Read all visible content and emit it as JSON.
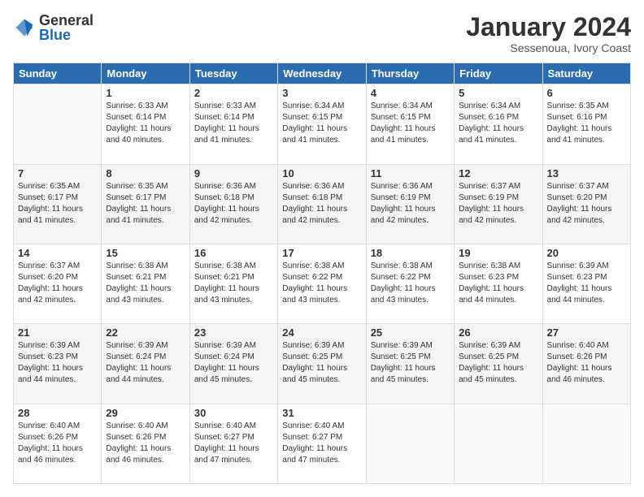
{
  "header": {
    "logo": {
      "general": "General",
      "blue": "Blue"
    },
    "title": "January 2024",
    "subtitle": "Sessenoua, Ivory Coast"
  },
  "weekdays": [
    "Sunday",
    "Monday",
    "Tuesday",
    "Wednesday",
    "Thursday",
    "Friday",
    "Saturday"
  ],
  "weeks": [
    [
      {
        "day": "",
        "sunrise": "",
        "sunset": "",
        "daylight": ""
      },
      {
        "day": "1",
        "sunrise": "Sunrise: 6:33 AM",
        "sunset": "Sunset: 6:14 PM",
        "daylight": "Daylight: 11 hours and 40 minutes."
      },
      {
        "day": "2",
        "sunrise": "Sunrise: 6:33 AM",
        "sunset": "Sunset: 6:14 PM",
        "daylight": "Daylight: 11 hours and 41 minutes."
      },
      {
        "day": "3",
        "sunrise": "Sunrise: 6:34 AM",
        "sunset": "Sunset: 6:15 PM",
        "daylight": "Daylight: 11 hours and 41 minutes."
      },
      {
        "day": "4",
        "sunrise": "Sunrise: 6:34 AM",
        "sunset": "Sunset: 6:15 PM",
        "daylight": "Daylight: 11 hours and 41 minutes."
      },
      {
        "day": "5",
        "sunrise": "Sunrise: 6:34 AM",
        "sunset": "Sunset: 6:16 PM",
        "daylight": "Daylight: 11 hours and 41 minutes."
      },
      {
        "day": "6",
        "sunrise": "Sunrise: 6:35 AM",
        "sunset": "Sunset: 6:16 PM",
        "daylight": "Daylight: 11 hours and 41 minutes."
      }
    ],
    [
      {
        "day": "7",
        "sunrise": "Sunrise: 6:35 AM",
        "sunset": "Sunset: 6:17 PM",
        "daylight": "Daylight: 11 hours and 41 minutes."
      },
      {
        "day": "8",
        "sunrise": "Sunrise: 6:35 AM",
        "sunset": "Sunset: 6:17 PM",
        "daylight": "Daylight: 11 hours and 41 minutes."
      },
      {
        "day": "9",
        "sunrise": "Sunrise: 6:36 AM",
        "sunset": "Sunset: 6:18 PM",
        "daylight": "Daylight: 11 hours and 42 minutes."
      },
      {
        "day": "10",
        "sunrise": "Sunrise: 6:36 AM",
        "sunset": "Sunset: 6:18 PM",
        "daylight": "Daylight: 11 hours and 42 minutes."
      },
      {
        "day": "11",
        "sunrise": "Sunrise: 6:36 AM",
        "sunset": "Sunset: 6:19 PM",
        "daylight": "Daylight: 11 hours and 42 minutes."
      },
      {
        "day": "12",
        "sunrise": "Sunrise: 6:37 AM",
        "sunset": "Sunset: 6:19 PM",
        "daylight": "Daylight: 11 hours and 42 minutes."
      },
      {
        "day": "13",
        "sunrise": "Sunrise: 6:37 AM",
        "sunset": "Sunset: 6:20 PM",
        "daylight": "Daylight: 11 hours and 42 minutes."
      }
    ],
    [
      {
        "day": "14",
        "sunrise": "Sunrise: 6:37 AM",
        "sunset": "Sunset: 6:20 PM",
        "daylight": "Daylight: 11 hours and 42 minutes."
      },
      {
        "day": "15",
        "sunrise": "Sunrise: 6:38 AM",
        "sunset": "Sunset: 6:21 PM",
        "daylight": "Daylight: 11 hours and 43 minutes."
      },
      {
        "day": "16",
        "sunrise": "Sunrise: 6:38 AM",
        "sunset": "Sunset: 6:21 PM",
        "daylight": "Daylight: 11 hours and 43 minutes."
      },
      {
        "day": "17",
        "sunrise": "Sunrise: 6:38 AM",
        "sunset": "Sunset: 6:22 PM",
        "daylight": "Daylight: 11 hours and 43 minutes."
      },
      {
        "day": "18",
        "sunrise": "Sunrise: 6:38 AM",
        "sunset": "Sunset: 6:22 PM",
        "daylight": "Daylight: 11 hours and 43 minutes."
      },
      {
        "day": "19",
        "sunrise": "Sunrise: 6:38 AM",
        "sunset": "Sunset: 6:23 PM",
        "daylight": "Daylight: 11 hours and 44 minutes."
      },
      {
        "day": "20",
        "sunrise": "Sunrise: 6:39 AM",
        "sunset": "Sunset: 6:23 PM",
        "daylight": "Daylight: 11 hours and 44 minutes."
      }
    ],
    [
      {
        "day": "21",
        "sunrise": "Sunrise: 6:39 AM",
        "sunset": "Sunset: 6:23 PM",
        "daylight": "Daylight: 11 hours and 44 minutes."
      },
      {
        "day": "22",
        "sunrise": "Sunrise: 6:39 AM",
        "sunset": "Sunset: 6:24 PM",
        "daylight": "Daylight: 11 hours and 44 minutes."
      },
      {
        "day": "23",
        "sunrise": "Sunrise: 6:39 AM",
        "sunset": "Sunset: 6:24 PM",
        "daylight": "Daylight: 11 hours and 45 minutes."
      },
      {
        "day": "24",
        "sunrise": "Sunrise: 6:39 AM",
        "sunset": "Sunset: 6:25 PM",
        "daylight": "Daylight: 11 hours and 45 minutes."
      },
      {
        "day": "25",
        "sunrise": "Sunrise: 6:39 AM",
        "sunset": "Sunset: 6:25 PM",
        "daylight": "Daylight: 11 hours and 45 minutes."
      },
      {
        "day": "26",
        "sunrise": "Sunrise: 6:39 AM",
        "sunset": "Sunset: 6:25 PM",
        "daylight": "Daylight: 11 hours and 45 minutes."
      },
      {
        "day": "27",
        "sunrise": "Sunrise: 6:40 AM",
        "sunset": "Sunset: 6:26 PM",
        "daylight": "Daylight: 11 hours and 46 minutes."
      }
    ],
    [
      {
        "day": "28",
        "sunrise": "Sunrise: 6:40 AM",
        "sunset": "Sunset: 6:26 PM",
        "daylight": "Daylight: 11 hours and 46 minutes."
      },
      {
        "day": "29",
        "sunrise": "Sunrise: 6:40 AM",
        "sunset": "Sunset: 6:26 PM",
        "daylight": "Daylight: 11 hours and 46 minutes."
      },
      {
        "day": "30",
        "sunrise": "Sunrise: 6:40 AM",
        "sunset": "Sunset: 6:27 PM",
        "daylight": "Daylight: 11 hours and 47 minutes."
      },
      {
        "day": "31",
        "sunrise": "Sunrise: 6:40 AM",
        "sunset": "Sunset: 6:27 PM",
        "daylight": "Daylight: 11 hours and 47 minutes."
      },
      {
        "day": "",
        "sunrise": "",
        "sunset": "",
        "daylight": ""
      },
      {
        "day": "",
        "sunrise": "",
        "sunset": "",
        "daylight": ""
      },
      {
        "day": "",
        "sunrise": "",
        "sunset": "",
        "daylight": ""
      }
    ]
  ]
}
